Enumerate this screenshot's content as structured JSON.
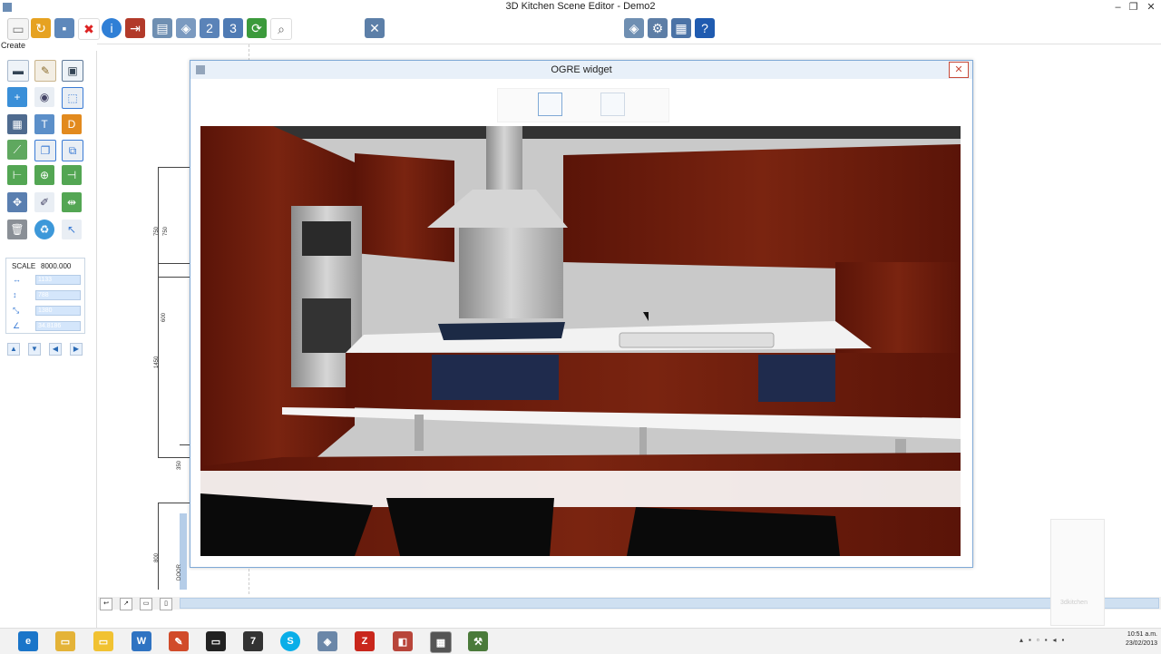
{
  "window": {
    "title": "3D Kitchen Scene Editor - Demo2",
    "minimize": "–",
    "maximize": "❐",
    "close": "✕"
  },
  "menu": {
    "create": "Create"
  },
  "toolbar": {
    "icons": [
      "new-icon",
      "open-icon",
      "save-icon",
      "delete-icon",
      "info-icon",
      "import-icon",
      "print-icon",
      "render-icon",
      "2d-view-icon",
      "3d-view-icon",
      "refresh-icon",
      "zoom-icon",
      "settings-tools-icon",
      "export-icon",
      "config-icon",
      "list-icon",
      "help-icon"
    ]
  },
  "scale": {
    "label": "SCALE",
    "value": "8000.000",
    "width": "1133",
    "height": "788",
    "depth": "1380",
    "angle": "34.8186"
  },
  "dialog": {
    "title": "OGRE widget",
    "close": "✕"
  },
  "plan": {
    "dims": [
      "750",
      "750",
      "600",
      "1450",
      "350",
      "800",
      "DOOR"
    ]
  },
  "watermark": {
    "text": "3dkitchen"
  },
  "tray": {
    "time": "10:51 a.m.",
    "date": "23/02/2013"
  },
  "colors": {
    "cabinet": "#6a1a0d",
    "accent": "#3a7bd5",
    "counter": "#f2f2f2",
    "navy": "#1f2b4d"
  }
}
